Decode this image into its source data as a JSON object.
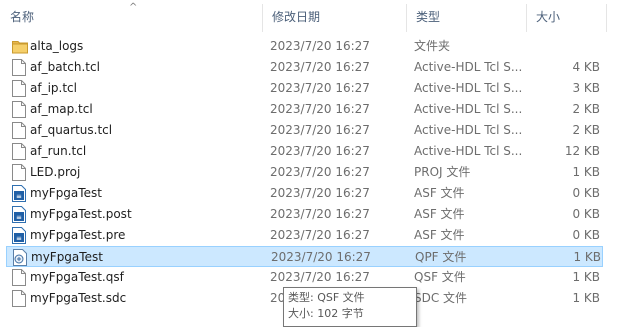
{
  "columns": {
    "name": "名称",
    "date": "修改日期",
    "type": "类型",
    "size": "大小"
  },
  "sort_indicator": "^",
  "files": [
    {
      "name": "alta_logs",
      "date": "2023/7/20 16:27",
      "type": "文件夹",
      "size": "",
      "icon": "folder-icon"
    },
    {
      "name": "af_batch.tcl",
      "date": "2023/7/20 16:27",
      "type": "Active-HDL Tcl S...",
      "size": "4 KB",
      "icon": "document-icon"
    },
    {
      "name": "af_ip.tcl",
      "date": "2023/7/20 16:27",
      "type": "Active-HDL Tcl S...",
      "size": "3 KB",
      "icon": "document-icon"
    },
    {
      "name": "af_map.tcl",
      "date": "2023/7/20 16:27",
      "type": "Active-HDL Tcl S...",
      "size": "2 KB",
      "icon": "document-icon"
    },
    {
      "name": "af_quartus.tcl",
      "date": "2023/7/20 16:27",
      "type": "Active-HDL Tcl S...",
      "size": "2 KB",
      "icon": "document-icon"
    },
    {
      "name": "af_run.tcl",
      "date": "2023/7/20 16:27",
      "type": "Active-HDL Tcl S...",
      "size": "12 KB",
      "icon": "document-icon"
    },
    {
      "name": "LED.proj",
      "date": "2023/7/20 16:27",
      "type": "PROJ 文件",
      "size": "1 KB",
      "icon": "document-icon"
    },
    {
      "name": "myFpgaTest",
      "date": "2023/7/20 16:27",
      "type": "ASF 文件",
      "size": "0 KB",
      "icon": "asf-file-icon"
    },
    {
      "name": "myFpgaTest.post",
      "date": "2023/7/20 16:27",
      "type": "ASF 文件",
      "size": "0 KB",
      "icon": "asf-file-icon"
    },
    {
      "name": "myFpgaTest.pre",
      "date": "2023/7/20 16:27",
      "type": "ASF 文件",
      "size": "0 KB",
      "icon": "asf-file-icon"
    },
    {
      "name": "myFpgaTest",
      "date": "2023/7/20 16:27",
      "type": "QPF 文件",
      "size": "1 KB",
      "icon": "qpf-file-icon",
      "selected": true
    },
    {
      "name": "myFpgaTest.qsf",
      "date": "2023/7/20 16:27",
      "type": "QSF 文件",
      "size": "1 KB",
      "icon": "document-icon"
    },
    {
      "name": "myFpgaTest.sdc",
      "date": "2023/7/20 16:27",
      "type": "SDC 文件",
      "size": "1 KB",
      "icon": "document-icon"
    }
  ],
  "tooltip": {
    "type_line": "类型: QSF 文件",
    "size_line": "大小: 102 字节"
  }
}
